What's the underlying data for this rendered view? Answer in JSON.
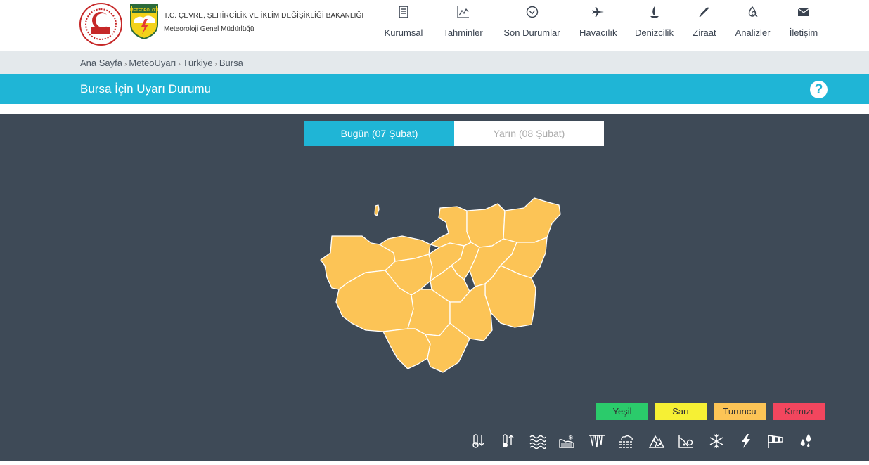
{
  "header": {
    "org_title": "T.C. ÇEVRE, ŞEHİRCİLİK VE İKLİM DEĞİŞİKLİĞİ BAKANLIĞI",
    "org_subtitle": "Meteoroloji Genel Müdürlüğü",
    "mgm_logo_text": "METEOROLOJİ",
    "nav": [
      {
        "label": "Kurumsal",
        "icon": "book-icon"
      },
      {
        "label": "Tahminler",
        "icon": "chart-line-icon"
      },
      {
        "label": "Son Durumlar",
        "icon": "check-circle-icon"
      },
      {
        "label": "Havacılık",
        "icon": "plane-icon"
      },
      {
        "label": "Denizcilik",
        "icon": "sailboat-icon"
      },
      {
        "label": "Ziraat",
        "icon": "wheat-icon"
      },
      {
        "label": "Analizler",
        "icon": "magnifier-drop-icon"
      },
      {
        "label": "İletişim",
        "icon": "envelope-icon"
      }
    ]
  },
  "breadcrumb": [
    "Ana Sayfa",
    "MeteoUyarı",
    "Türkiye",
    "Bursa"
  ],
  "page_title": "Bursa İçin Uyarı Durumu",
  "help_label": "?",
  "tabs": {
    "today": "Bugün (07 Şubat)",
    "tomorrow": "Yarın (08 Şubat)"
  },
  "map": {
    "region_color": "#fcc456",
    "border_color": "#ffffff",
    "warning_level": "Turuncu"
  },
  "legend": [
    {
      "label": "Yeşil",
      "color": "#2bcb6b"
    },
    {
      "label": "Sarı",
      "color": "#f6f034"
    },
    {
      "label": "Turuncu",
      "color": "#fcc456"
    },
    {
      "label": "Kırmızı",
      "color": "#f2465e"
    }
  ],
  "hazards": [
    "cold-thermometer-icon",
    "hot-thermometer-icon",
    "waves-icon",
    "snowy-road-icon",
    "icicle-icon",
    "fog-icon",
    "avalanche-icon",
    "landslide-icon",
    "snowflake-icon",
    "lightning-icon",
    "windsock-icon",
    "heavy-rain-icon"
  ]
}
